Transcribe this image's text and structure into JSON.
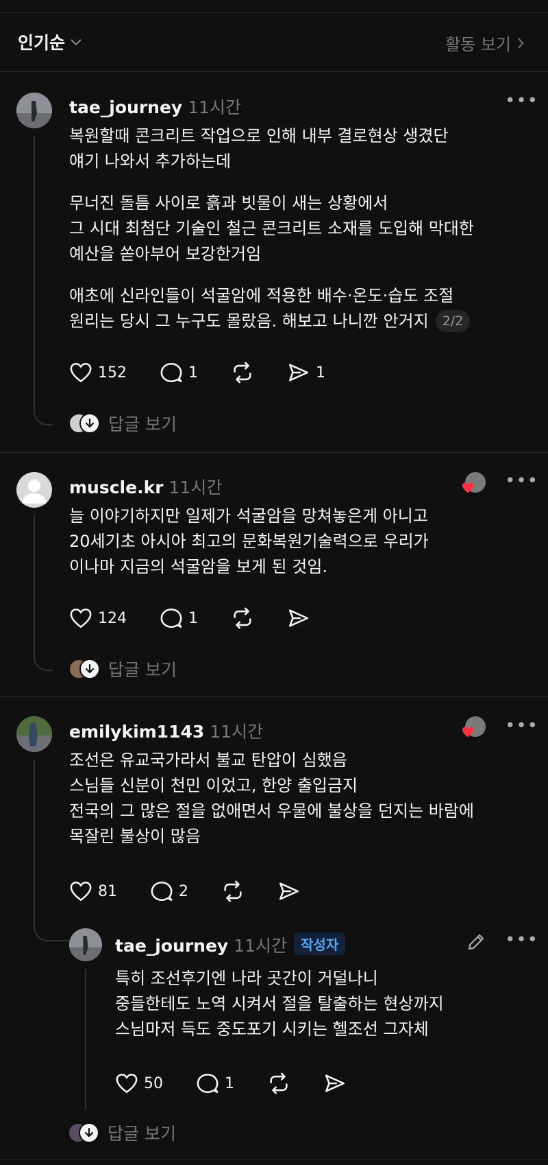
{
  "header": {
    "sort_label": "인기순",
    "activity_label": "활동 보기"
  },
  "comments": [
    {
      "username": "tae_journey",
      "time": "11시간",
      "paragraphs": [
        "복원할때 콘크리트 작업으로 인해 내부 결로현상 생겼단\n얘기 나와서 추가하는데",
        "무너진 돌틈 사이로 흙과 빗물이 새는 상황에서\n그 시대 최첨단 기술인 철근 콘크리트 소재를 도입해 막대한\n예산을 쏟아부어 보강한거임",
        "애초에 신라인들이 석굴암에 적용한 배수·온도·습도 조절\n원리는 당시 그 누구도 몰랐음. 해보고 나니깐 안거지"
      ],
      "page_indicator": "2/2",
      "likes": "152",
      "replies": "1",
      "shares": "1",
      "view_replies": "답글 보기"
    },
    {
      "username": "muscle.kr",
      "time": "11시간",
      "paragraphs": [
        "늘 이야기하지만 일제가 석굴암을 망쳐놓은게 아니고\n20세기초 아시아 최고의 문화복원기술력으로 우리가\n이나마 지금의 석굴암을 보게 된 것임."
      ],
      "likes": "124",
      "replies": "1",
      "view_replies": "답글 보기"
    },
    {
      "username": "emilykim1143",
      "time": "11시간",
      "paragraphs": [
        "조선은 유교국가라서 불교 탄압이 심했음\n스님들 신분이 천민 이었고, 한양 출입금지\n전국의 그 많은 절을 없애면서 우물에 불상을 던지는 바람에\n목잘린 불상이 많음"
      ],
      "likes": "81",
      "replies": "2"
    },
    {
      "username": "tae_journey",
      "time": "11시간",
      "badge": "작성자",
      "paragraphs": [
        "특히 조선후기엔 나라 곳간이 거덜나니\n중들한테도 노역 시켜서 절을 탈출하는 현상까지\n스님마저 득도 중도포기 시키는 헬조선 그자체"
      ],
      "likes": "50",
      "replies": "1",
      "view_replies": "답글 보기"
    }
  ],
  "colors": {
    "background": "#101010",
    "text": "#f3f5f7",
    "secondary": "#777777",
    "like_heart": "#ff3040",
    "author_badge": "#5aa5f0"
  }
}
